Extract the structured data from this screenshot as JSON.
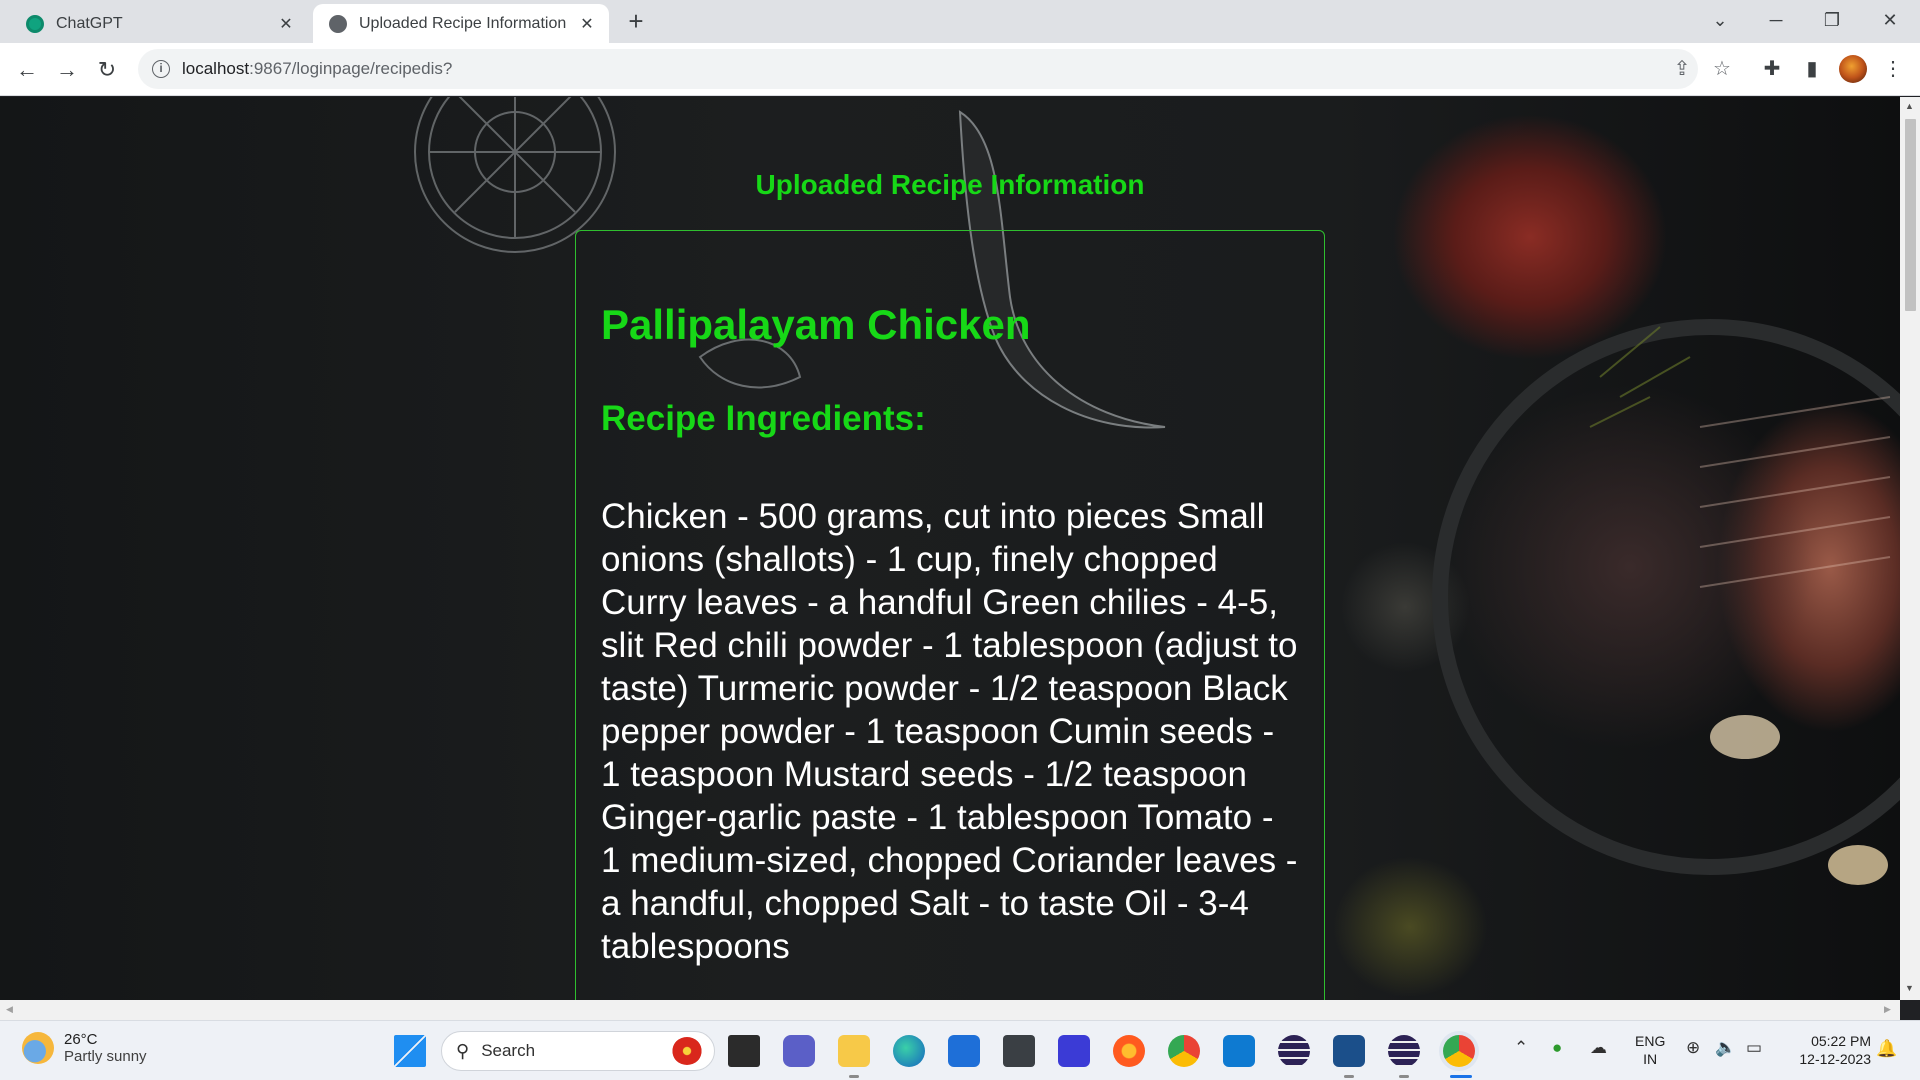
{
  "browser": {
    "tabs": [
      {
        "title": "ChatGPT",
        "active": false,
        "icon": "chatgpt-favicon"
      },
      {
        "title": "Uploaded Recipe Information",
        "active": true,
        "icon": "globe-favicon"
      }
    ],
    "new_tab_label": "+",
    "address": {
      "host": "localhost",
      "path": ":9867/loginpage/recipedis?"
    }
  },
  "page": {
    "heading": "Uploaded Recipe Information",
    "recipe_name": "Pallipalayam Chicken",
    "ingredients_heading": "Recipe Ingredients:",
    "ingredients_text": "Chicken - 500 grams, cut into pieces Small onions (shallots) - 1 cup, finely chopped Curry leaves - a handful Green chilies - 4-5, slit Red chili powder - 1 tablespoon (adjust to taste) Turmeric powder - 1/2 teaspoon Black pepper powder - 1 teaspoon Cumin seeds - 1 teaspoon Mustard seeds - 1/2 teaspoon Ginger-garlic paste - 1 tablespoon Tomato - 1 medium-sized, chopped Coriander leaves - a handful, chopped Salt - to taste Oil - 3-4 tablespoons"
  },
  "taskbar": {
    "weather": {
      "temp": "26°C",
      "condition": "Partly sunny"
    },
    "search_placeholder": "Search",
    "language": {
      "line1": "ENG",
      "line2": "IN"
    },
    "clock": {
      "time": "05:22 PM",
      "date": "12-12-2023"
    }
  },
  "colors": {
    "accent_green": "#17d817",
    "card_border": "#2fbf2f",
    "ingredient_text": "#ffffff"
  }
}
